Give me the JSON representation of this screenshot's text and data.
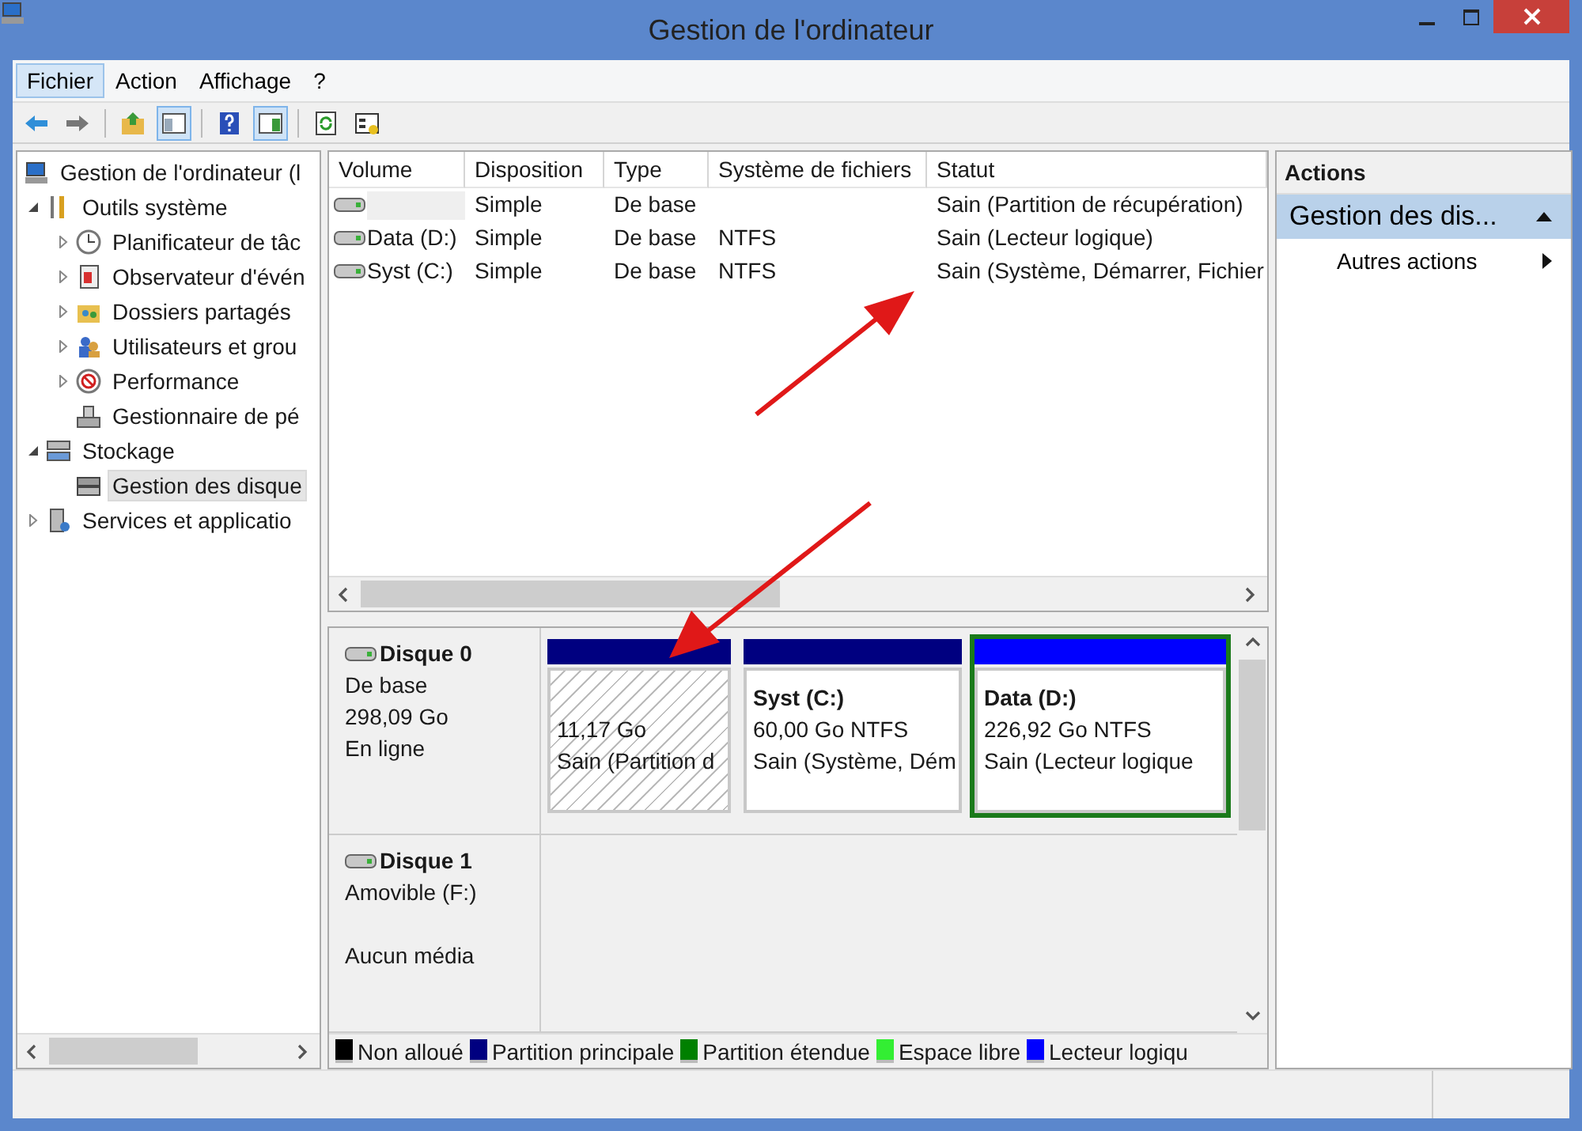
{
  "window": {
    "title": "Gestion de l'ordinateur"
  },
  "menu": [
    {
      "label": "Fichier",
      "selected": true
    },
    {
      "label": "Action",
      "selected": false
    },
    {
      "label": "Affichage",
      "selected": false
    },
    {
      "label": "?",
      "selected": false
    }
  ],
  "toolbar": [
    {
      "pressed": false
    },
    {
      "pressed": false
    },
    {
      "pressed": false
    },
    {
      "pressed": true
    },
    {
      "pressed": false
    },
    {
      "pressed": true
    },
    {
      "pressed": false
    },
    {
      "pressed": false
    }
  ],
  "tree": [
    {
      "label": "Gestion de l'ordinateur (l",
      "selected": false,
      "children": [
        {
          "label": "Outils système",
          "expanded": true,
          "selected": false,
          "children": [
            {
              "label": "Planificateur de tâc",
              "expanded": false,
              "selected": false
            },
            {
              "label": "Observateur d'évén",
              "expanded": false,
              "selected": false
            },
            {
              "label": "Dossiers partagés",
              "expanded": false,
              "selected": false
            },
            {
              "label": "Utilisateurs et grou",
              "expanded": false,
              "selected": false
            },
            {
              "label": "Performance",
              "expanded": false,
              "selected": false
            },
            {
              "label": "Gestionnaire de pé",
              "selected": false
            }
          ]
        },
        {
          "label": "Stockage",
          "expanded": true,
          "selected": false,
          "children": [
            {
              "label": "Gestion des disque",
              "selected": true
            }
          ]
        },
        {
          "label": "Services et applicatio",
          "expanded": false,
          "selected": false
        }
      ]
    }
  ],
  "volumes": {
    "columns": [
      "Volume",
      "Disposition",
      "Type",
      "Système de fichiers",
      "Statut"
    ],
    "rows": [
      {
        "layout": "Simple",
        "type": "De base",
        "status": "Sain (Partition de récupération)"
      },
      {
        "volume": "Data (D:)",
        "layout": "Simple",
        "type": "De base",
        "file_system": "NTFS",
        "status": "Sain (Lecteur logique)"
      },
      {
        "volume": "Syst (C:)",
        "layout": "Simple",
        "type": "De base",
        "file_system": "NTFS",
        "status": "Sain (Système, Démarrer, Fichier"
      }
    ]
  },
  "disks": [
    {
      "name": "Disque 0",
      "type": "De base",
      "size": "298,09 Go",
      "state": "En ligne",
      "partitions": [
        {
          "size": "11,17 Go",
          "status": "Sain (Partition d",
          "color": "#000080",
          "hatched": true,
          "selected": false
        },
        {
          "name": "Syst  (C:)",
          "size": "60,00 Go NTFS",
          "status": "Sain (Système, Dém",
          "color": "#000080",
          "hatched": false,
          "selected": false
        },
        {
          "name": "Data  (D:)",
          "size": "226,92 Go NTFS",
          "status": "Sain (Lecteur logique",
          "color": "#0000ff",
          "hatched": false,
          "selected": true
        }
      ]
    },
    {
      "name": "Disque 1",
      "type": "Amovible (F:)",
      "state": "Aucun média"
    }
  ],
  "legend": [
    {
      "label": "Non alloué",
      "color": "#000000"
    },
    {
      "label": "Partition principale",
      "color": "#000080"
    },
    {
      "label": "Partition étendue",
      "color": "#008000"
    },
    {
      "label": "Espace libre",
      "color": "#33ee33"
    },
    {
      "label": "Lecteur logiqu",
      "color": "#0000ff"
    }
  ],
  "actions": {
    "title": "Actions",
    "section": {
      "label": "Gestion des dis...",
      "expanded": true
    },
    "items": [
      {
        "label": "Autres actions"
      }
    ]
  }
}
